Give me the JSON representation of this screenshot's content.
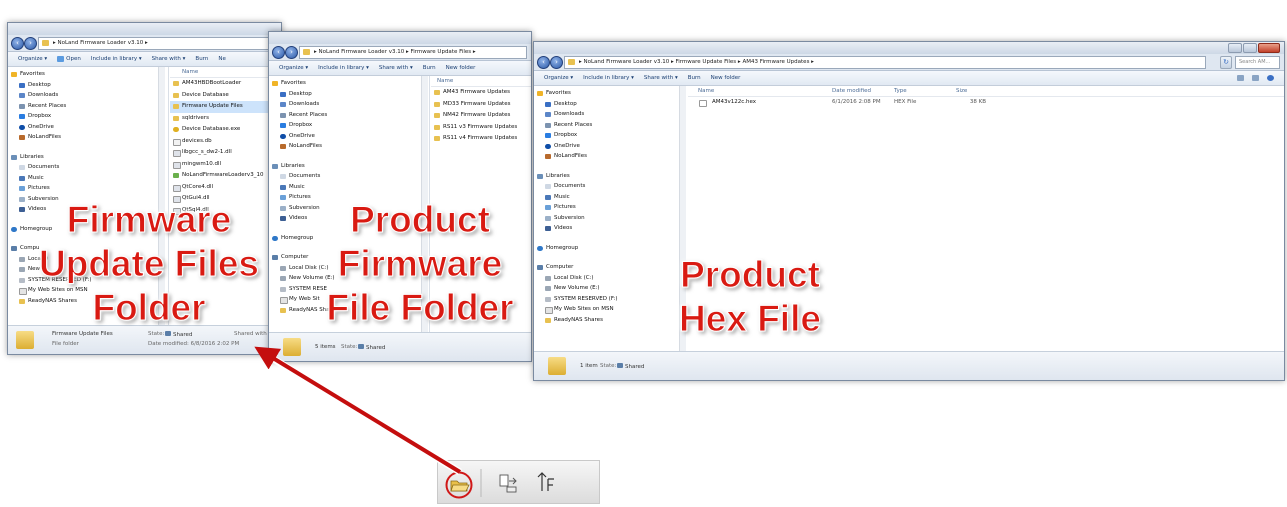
{
  "window1": {
    "breadcrumb": [
      "NoLand Firmware Loader v3.10"
    ],
    "toolbar": [
      "Organize ▾",
      "Open",
      "Include in library ▾",
      "Share with ▾",
      "Burn",
      "Ne"
    ],
    "nav": [
      "Favorites",
      "Desktop",
      "Downloads",
      "Recent Places",
      "Dropbox",
      "OneDrive",
      "NoLandFiles",
      "Libraries",
      "Documents",
      "Music",
      "Pictures",
      "Subversion",
      "Videos",
      "Homegroup",
      "Compu",
      "Local D",
      "New V",
      "SYSTEM RESERVED (F:)",
      "My Web Sites on MSN",
      "ReadyNAS Shares"
    ],
    "col_name": "Name",
    "files": [
      "AM43HBDBootLoader",
      "Device Database",
      "Firmware Update Files",
      "sqldrivers",
      "Device Database.exe",
      "devices.db",
      "libgcc_s_dw2-1.dll",
      "mingwm10.dll",
      "NoLandFirmwareLoaderv3_10",
      "QtCore4.dll",
      "QtGui4.dll",
      "QtSql4.dll"
    ],
    "status": {
      "name": "Firmware Update Files",
      "state_label": "State:",
      "state": "Shared",
      "shared_with": "Shared with",
      "type": "File folder",
      "date_label": "Date modified: 6/8/2016 2:02 PM"
    }
  },
  "window2": {
    "breadcrumb": [
      "NoLand Firmware Loader v3.10",
      "Firmware Update Files"
    ],
    "toolbar": [
      "Organize ▾",
      "Include in library ▾",
      "Share with ▾",
      "Burn",
      "New folder"
    ],
    "nav": [
      "Favorites",
      "Desktop",
      "Downloads",
      "Recent Places",
      "Dropbox",
      "OneDrive",
      "NoLandFiles",
      "Libraries",
      "Documents",
      "Music",
      "Pictures",
      "Subversion",
      "Videos",
      "Homegroup",
      "Computer",
      "Local Disk (C:)",
      "New Volume (E:)",
      "SYSTEM RESE",
      "My Web Sit",
      "ReadyNAS Shares"
    ],
    "col_name": "Name",
    "files": [
      "AM43 Firmware Updates",
      "MD33 Firmware Updates",
      "NM42 Firmware Updates",
      "RS11 v3 Firmware Updates",
      "RS11 v4 Firmware Updates"
    ],
    "status": {
      "items": "5 items",
      "state_label": "State:",
      "state": "Shared"
    }
  },
  "window3": {
    "breadcrumb": [
      "NoLand Firmware Loader v3.10",
      "Firmware Update Files",
      "AM43 Firmware Updates"
    ],
    "search_placeholder": "Search AM...",
    "toolbar": [
      "Organize ▾",
      "Include in library ▾",
      "Share with ▾",
      "Burn",
      "New folder"
    ],
    "nav": [
      "Favorites",
      "Desktop",
      "Downloads",
      "Recent Places",
      "Dropbox",
      "OneDrive",
      "NoLandFiles",
      "Libraries",
      "Documents",
      "Music",
      "Pictures",
      "Subversion",
      "Videos",
      "Homegroup",
      "Computer",
      "Local Disk (C:)",
      "New Volume (E:)",
      "SYSTEM RESERVED (F:)",
      "My Web Sites on MSN",
      "ReadyNAS Shares"
    ],
    "columns": [
      "Name",
      "Date modified",
      "Type",
      "Size"
    ],
    "files": [
      {
        "name": "AM43v122c.hex",
        "date": "6/1/2016 2:08 PM",
        "type": "HEX File",
        "size": "38 KB"
      }
    ],
    "status": {
      "items": "1 item",
      "state_label": "State:",
      "state": "Shared"
    }
  },
  "labels": {
    "l1": [
      "Firmware",
      "Update Files",
      "Folder"
    ],
    "l2": [
      "Product",
      "Firmware",
      "File Folder"
    ],
    "l3": [
      "Product",
      "Hex File"
    ]
  },
  "colors": {
    "label_red": "#d91a12",
    "arrow_red": "#c40e0e",
    "folder_yellow": "#e8c150"
  }
}
